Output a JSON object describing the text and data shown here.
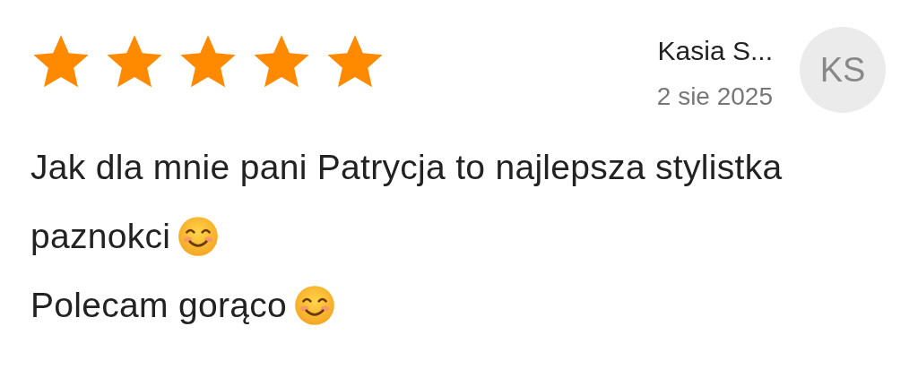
{
  "review": {
    "stars": 5,
    "author": "Kasia S...",
    "date": "2 sie 2025",
    "initials": "KS",
    "paragraphs": [
      {
        "text": "Jak dla mnie pani Patrycja to najlepsza stylistka paznokci",
        "emoji": true
      },
      {
        "text": "Polecam gorąco",
        "emoji": true
      }
    ]
  }
}
